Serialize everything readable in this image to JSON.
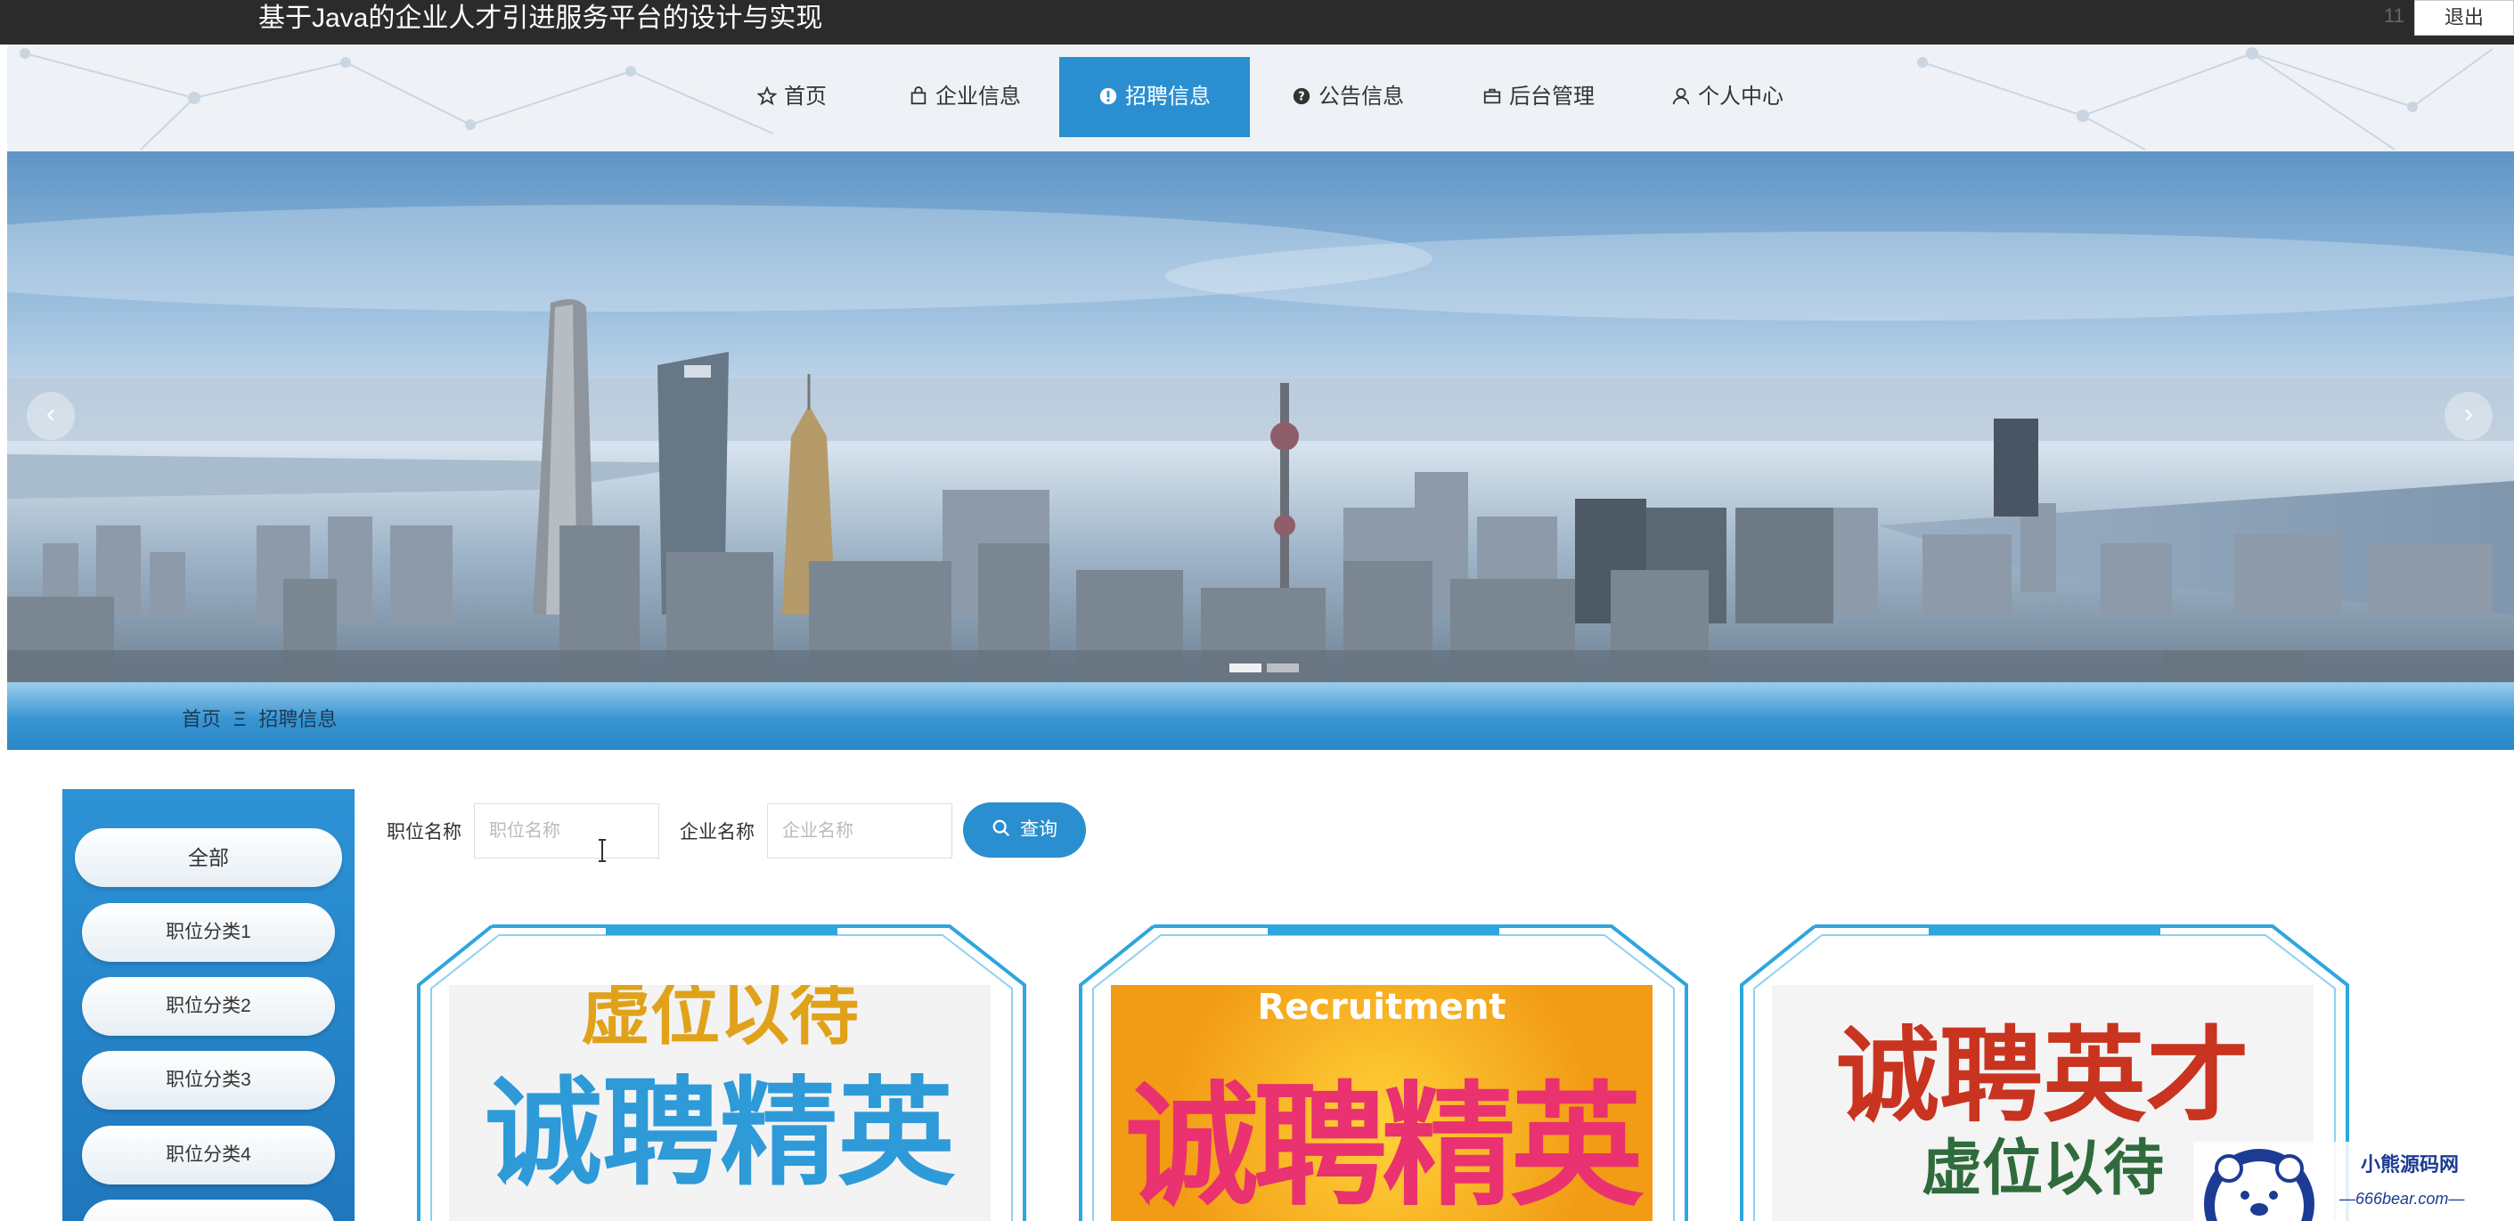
{
  "header": {
    "title": "基于Java的企业人才引进服务平台的设计与实现",
    "user_count": "11",
    "logout_label": "退出"
  },
  "nav": {
    "items": [
      {
        "label": "首页",
        "icon": "star-icon"
      },
      {
        "label": "企业信息",
        "icon": "bag-icon"
      },
      {
        "label": "招聘信息",
        "icon": "alert-circle-icon"
      },
      {
        "label": "公告信息",
        "icon": "question-circle-icon"
      },
      {
        "label": "后台管理",
        "icon": "briefcase-icon"
      },
      {
        "label": "个人中心",
        "icon": "user-icon"
      }
    ],
    "active_index": 2,
    "active_color": "#2a8fd0"
  },
  "banner": {
    "prev_label": "‹",
    "next_label": "›",
    "slide_count": 2,
    "active_slide": 0
  },
  "breadcrumb": {
    "home": "首页",
    "separator": "Ξ",
    "current": "招聘信息"
  },
  "categories": {
    "items": [
      "全部",
      "职位分类1",
      "职位分类2",
      "职位分类3",
      "职位分类4"
    ]
  },
  "search": {
    "position_label": "职位名称",
    "position_placeholder": "职位名称",
    "company_label": "企业名称",
    "company_placeholder": "企业名称",
    "button_label": "查询"
  },
  "cards": [
    {
      "line1": "虚位以待",
      "line2": "诚聘精英",
      "accent": "#2e9ad8"
    },
    {
      "line1": "Recruitment",
      "line2": "诚聘精英",
      "accent": "#e9326f"
    },
    {
      "line1": "诚聘英才",
      "line2": "虚位以待",
      "accent": "#c8341f"
    }
  ],
  "watermark": {
    "title": "小熊源码网",
    "url": "—666bear.com—"
  }
}
